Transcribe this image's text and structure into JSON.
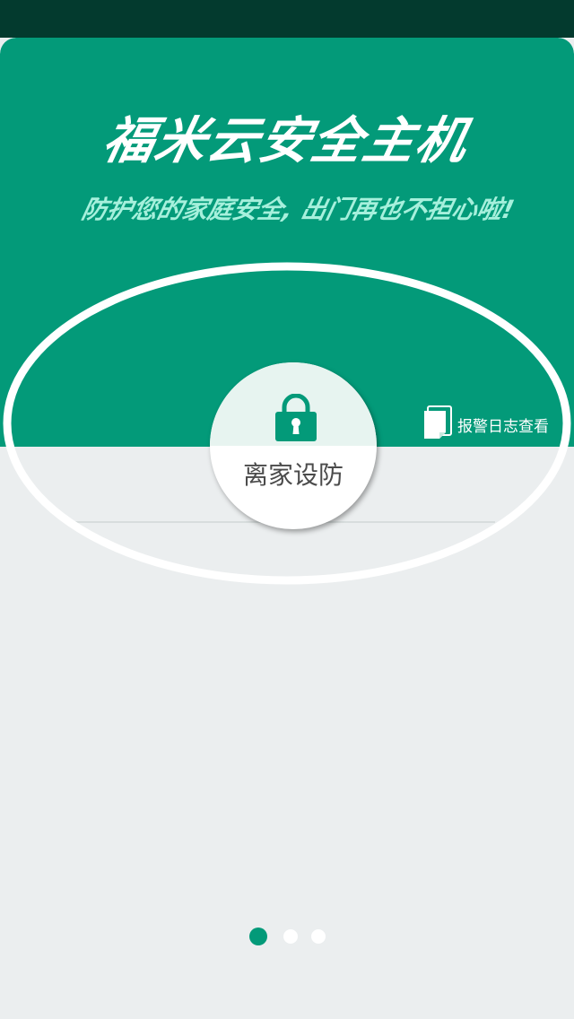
{
  "app": {
    "title": "福米云安全主机",
    "subtitle": "防护您的家庭安全, 出门再也不担心啦!"
  },
  "arm_button": {
    "label": "离家设防",
    "icon": "lock-icon"
  },
  "alarm_log": {
    "label": "报警日志查看",
    "icon": "document-icon"
  },
  "pager": {
    "pages": 3,
    "current": 1
  },
  "colors": {
    "primary_green": "#039a79",
    "status_bar": "#033a2e",
    "subtitle_mint": "#a6f0dc",
    "background": "#ebeeef"
  }
}
